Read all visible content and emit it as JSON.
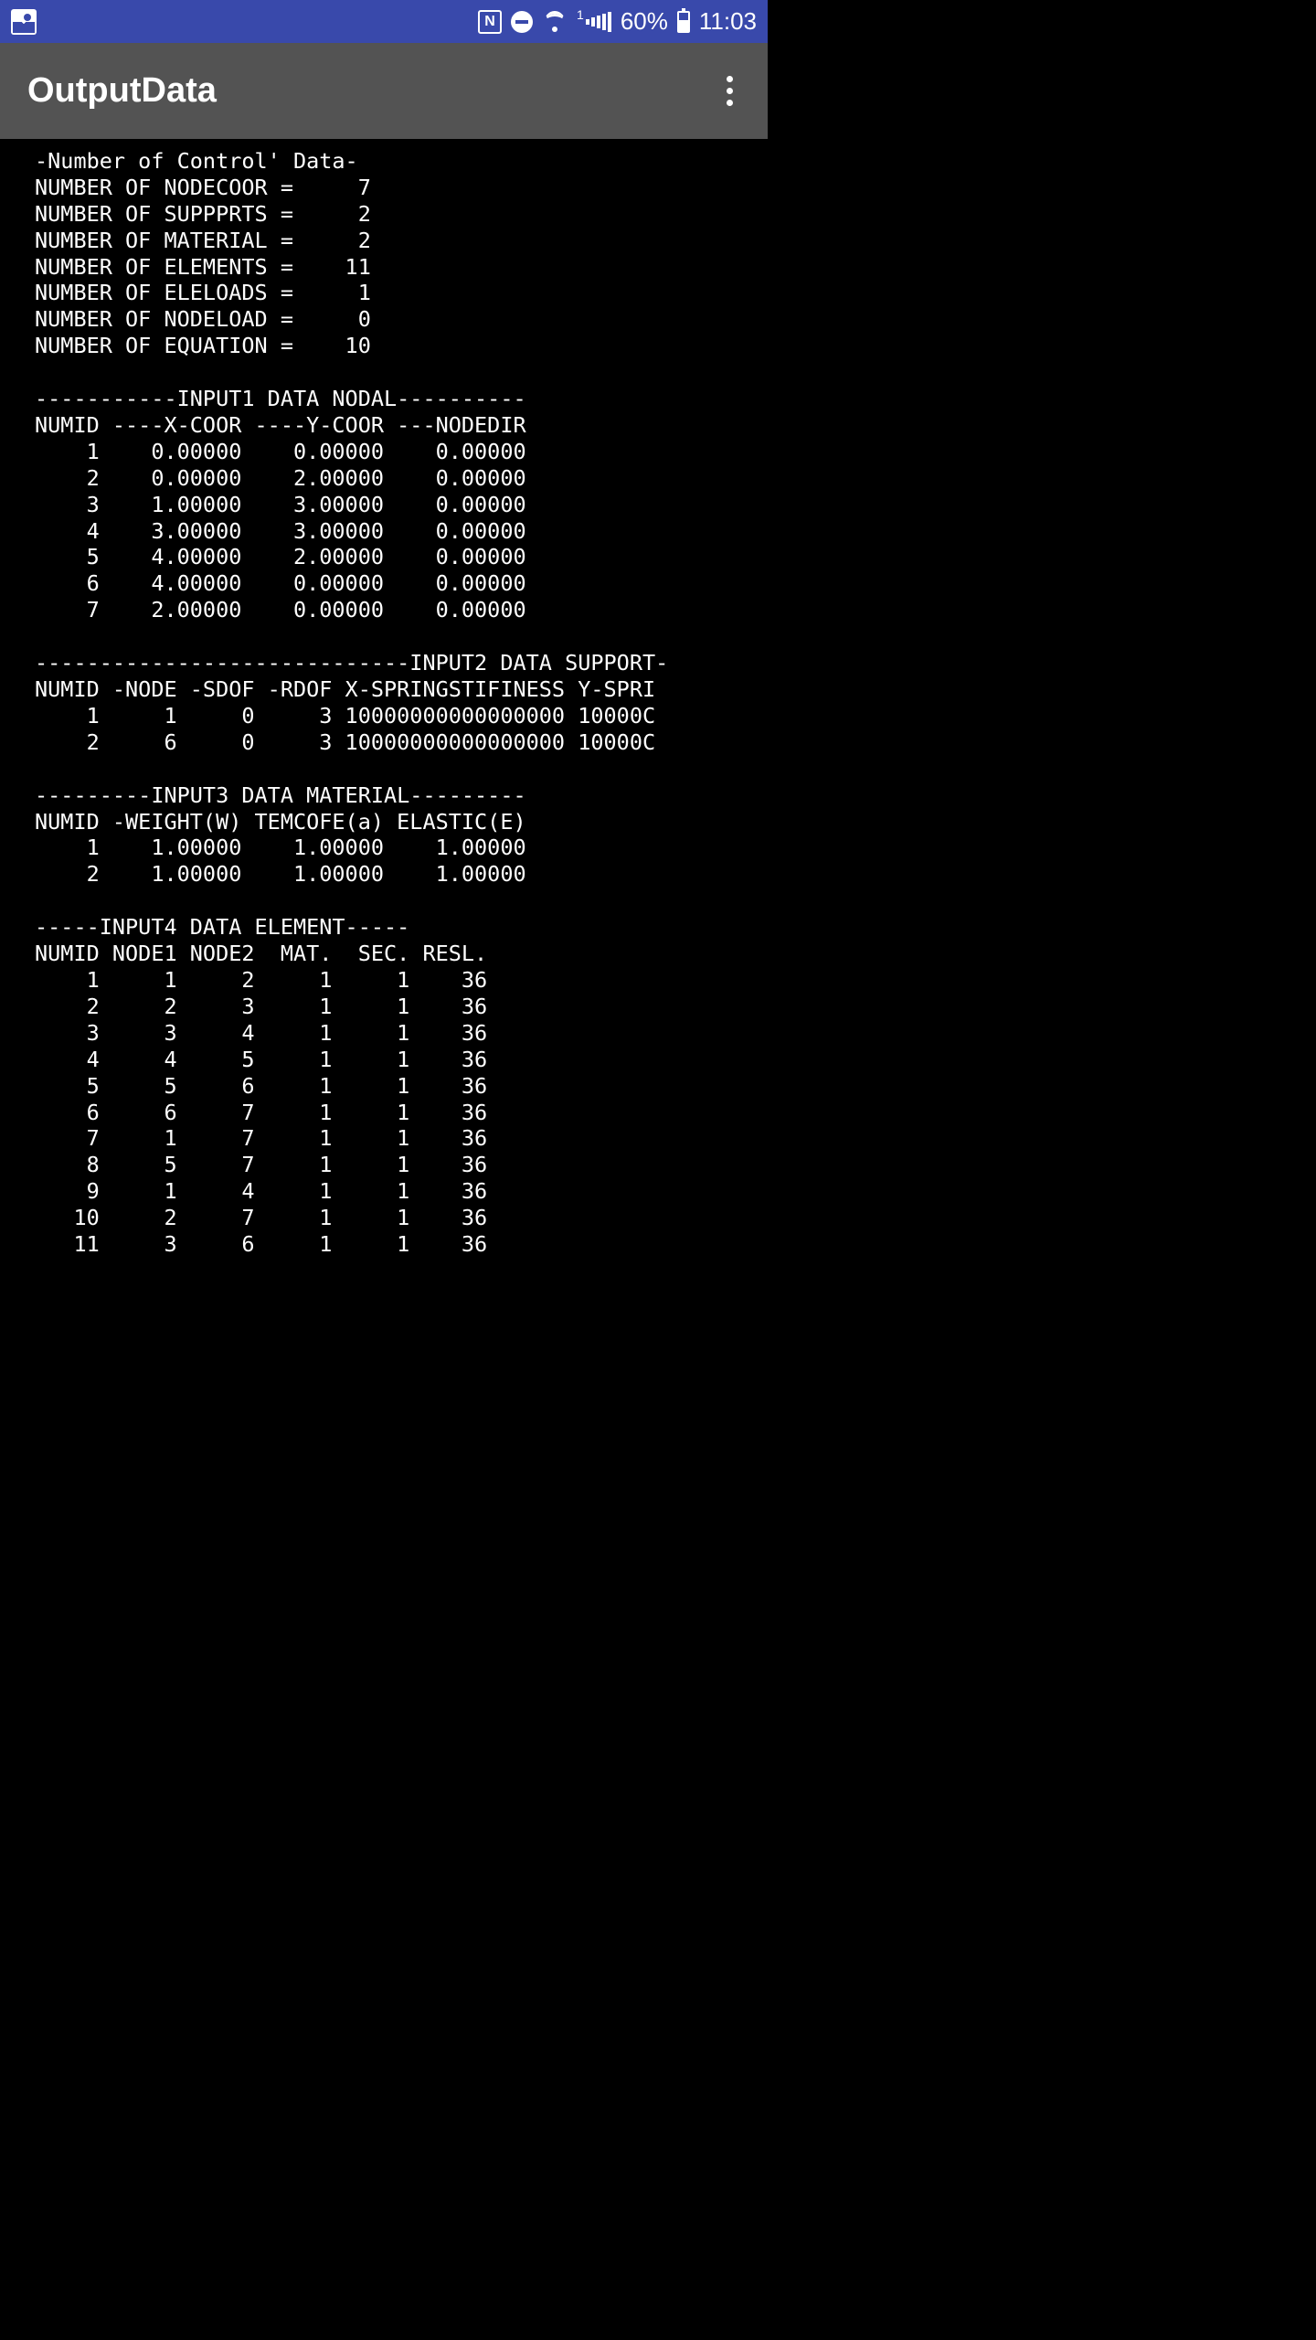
{
  "status": {
    "battery_pct": "60%",
    "clock": "11:03",
    "cell_label": "1"
  },
  "app": {
    "title": "OutputData"
  },
  "control_data": {
    "header": "-Number of Control' Data-",
    "rows": [
      {
        "label": "NUMBER OF NODECOOR",
        "value": 7
      },
      {
        "label": "NUMBER OF SUPPPRTS",
        "value": 2
      },
      {
        "label": "NUMBER OF MATERIAL",
        "value": 2
      },
      {
        "label": "NUMBER OF ELEMENTS",
        "value": 11
      },
      {
        "label": "NUMBER OF ELELOADS",
        "value": 1
      },
      {
        "label": "NUMBER OF NODELOAD",
        "value": 0
      },
      {
        "label": "NUMBER OF EQUATION",
        "value": 10
      }
    ]
  },
  "input1": {
    "header": "-----------INPUT1 DATA NODAL----------",
    "columns": "NUMID ----X-COOR ----Y-COOR ---NODEDIR",
    "rows": [
      {
        "id": 1,
        "x": "0.00000",
        "y": "0.00000",
        "dir": "0.00000"
      },
      {
        "id": 2,
        "x": "0.00000",
        "y": "2.00000",
        "dir": "0.00000"
      },
      {
        "id": 3,
        "x": "1.00000",
        "y": "3.00000",
        "dir": "0.00000"
      },
      {
        "id": 4,
        "x": "3.00000",
        "y": "3.00000",
        "dir": "0.00000"
      },
      {
        "id": 5,
        "x": "4.00000",
        "y": "2.00000",
        "dir": "0.00000"
      },
      {
        "id": 6,
        "x": "4.00000",
        "y": "0.00000",
        "dir": "0.00000"
      },
      {
        "id": 7,
        "x": "2.00000",
        "y": "0.00000",
        "dir": "0.00000"
      }
    ]
  },
  "input2": {
    "header": "-----------------------------INPUT2 DATA SUPPORT-",
    "columns": "NUMID -NODE -SDOF -RDOF X-SPRINGSTIFINESS Y-SPRI",
    "rows": [
      {
        "id": 1,
        "node": 1,
        "sdof": 0,
        "rdof": 3,
        "xs": "10000000000000000",
        "ys": "10000C"
      },
      {
        "id": 2,
        "node": 6,
        "sdof": 0,
        "rdof": 3,
        "xs": "10000000000000000",
        "ys": "10000C"
      }
    ]
  },
  "input3": {
    "header": "---------INPUT3 DATA MATERIAL---------",
    "columns": "NUMID -WEIGHT(W) TEMCOFE(a) ELASTIC(E)",
    "rows": [
      {
        "id": 1,
        "w": "1.00000",
        "a": "1.00000",
        "e": "1.00000"
      },
      {
        "id": 2,
        "w": "1.00000",
        "a": "1.00000",
        "e": "1.00000"
      }
    ]
  },
  "input4": {
    "header": "-----INPUT4 DATA ELEMENT-----",
    "columns": "NUMID NODE1 NODE2  MAT.  SEC. RESL.",
    "rows": [
      {
        "id": 1,
        "n1": 1,
        "n2": 2,
        "mat": 1,
        "sec": 1,
        "resl": 36
      },
      {
        "id": 2,
        "n1": 2,
        "n2": 3,
        "mat": 1,
        "sec": 1,
        "resl": 36
      },
      {
        "id": 3,
        "n1": 3,
        "n2": 4,
        "mat": 1,
        "sec": 1,
        "resl": 36
      },
      {
        "id": 4,
        "n1": 4,
        "n2": 5,
        "mat": 1,
        "sec": 1,
        "resl": 36
      },
      {
        "id": 5,
        "n1": 5,
        "n2": 6,
        "mat": 1,
        "sec": 1,
        "resl": 36
      },
      {
        "id": 6,
        "n1": 6,
        "n2": 7,
        "mat": 1,
        "sec": 1,
        "resl": 36
      },
      {
        "id": 7,
        "n1": 1,
        "n2": 7,
        "mat": 1,
        "sec": 1,
        "resl": 36
      },
      {
        "id": 8,
        "n1": 5,
        "n2": 7,
        "mat": 1,
        "sec": 1,
        "resl": 36
      },
      {
        "id": 9,
        "n1": 1,
        "n2": 4,
        "mat": 1,
        "sec": 1,
        "resl": 36
      },
      {
        "id": 10,
        "n1": 2,
        "n2": 7,
        "mat": 1,
        "sec": 1,
        "resl": 36
      },
      {
        "id": 11,
        "n1": 3,
        "n2": 6,
        "mat": 1,
        "sec": 1,
        "resl": 36
      }
    ]
  }
}
